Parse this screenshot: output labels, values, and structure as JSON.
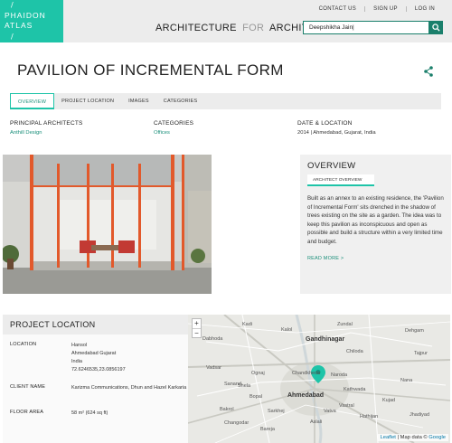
{
  "header": {
    "logo_line1": "PHAIDON",
    "logo_line2": "ATLAS",
    "top_links": [
      "CONTACT US",
      "SIGN UP",
      "LOG IN"
    ],
    "tagline_a": "ARCHITECTURE",
    "tagline_for": "FOR",
    "tagline_b": "ARCHITECTS",
    "search_value": "Deepshikha Jain|",
    "search_icon": "search-icon"
  },
  "page": {
    "title": "PAVILION OF INCREMENTAL FORM",
    "share_icon": "share-icon"
  },
  "tabs": [
    {
      "label": "OVERVIEW",
      "active": true
    },
    {
      "label": "PROJECT LOCATION",
      "active": false
    },
    {
      "label": "IMAGES",
      "active": false
    },
    {
      "label": "CATEGORIES",
      "active": false
    }
  ],
  "meta": {
    "architects_label": "PRINCIPAL ARCHITECTS",
    "architects_value": "Anthill Design",
    "categories_label": "CATEGORIES",
    "categories_value": "Offices",
    "date_label": "DATE & LOCATION",
    "date_value": "2014 | Ahmedabad, Gujarat, India"
  },
  "overview": {
    "title": "OVERVIEW",
    "subtab": "ARCHITECT OVERVIEW",
    "text": "Built as an annex to an existing residence, the 'Pavilion of Incremental Form' sits drenched in the shadow of trees existing on the site as a garden. The idea was to keep this pavilion as inconspicuous and open as possible and build a structure within a very limited time and budget.",
    "read_more": "READ MORE >"
  },
  "location": {
    "title": "PROJECT LOCATION",
    "location_label": "LOCATION",
    "location_lines": [
      "Hansol",
      "Ahmedabad Gujarat",
      "India",
      "72.6246535,23.0856197"
    ],
    "client_label": "CLIENT NAME",
    "client_value": "Karizma Communications, Dhun and Hazel Karkaria",
    "area_label": "FLOOR AREA",
    "area_value": "58 m² (624 sq ft)"
  },
  "map": {
    "zoom_in": "+",
    "zoom_out": "−",
    "attrib_leaflet": "Leaflet",
    "attrib_sep": " | Map data © ",
    "attrib_google": "Google",
    "labels": [
      "Gandhinagar",
      "Ahmedabad",
      "Kalol",
      "Sanand",
      "Dehgam",
      "Dabhoda",
      "Chandkheda",
      "Naroda",
      "Kathwada",
      "Vastral",
      "Bakrol",
      "Bareja",
      "Changodar",
      "Hathijan",
      "Aslali",
      "Chiloda",
      "Sarkhej",
      "Bopal",
      "Vatva",
      "Nana",
      "Vadsar",
      "Kadi",
      "Zundal",
      "Ognaj",
      "Shela",
      "Tajpur",
      "Jhadiyad",
      "Kujad"
    ],
    "colors": {
      "road": "#ffffff",
      "highway": "#c9c9c2",
      "water": "#cfd7da",
      "marker": "#1ec4a8"
    }
  },
  "colors": {
    "accent": "#1ec4a8",
    "accent_dark": "#1a7f6b",
    "link": "#1a8f7a"
  }
}
